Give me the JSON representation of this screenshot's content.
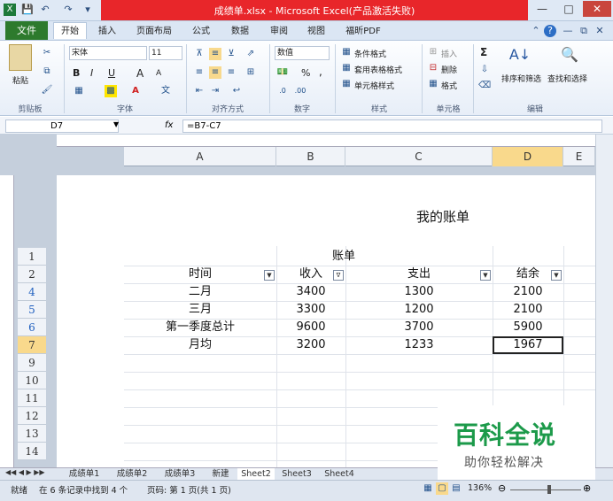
{
  "window": {
    "title": "成绩单.xlsx - Microsoft Excel(产品激活失败)",
    "app_icon": "X"
  },
  "ribbon": {
    "tabs": [
      "文件",
      "开始",
      "插入",
      "页面布局",
      "公式",
      "数据",
      "审阅",
      "视图",
      "福昕PDF"
    ],
    "clipboard": {
      "paste": "粘贴",
      "label": "剪贴板"
    },
    "font": {
      "name": "宋体",
      "size": "11",
      "bold": "B",
      "italic": "I",
      "underline": "U",
      "grow": "A",
      "shrink": "A",
      "label": "字体"
    },
    "alignment": {
      "label": "对齐方式"
    },
    "number": {
      "format": "数值",
      "percent": "%",
      "comma": ",",
      "label": "数字"
    },
    "styles": {
      "conditional": "条件格式",
      "table": "套用表格格式",
      "cell": "单元格样式",
      "label": "样式"
    },
    "cells": {
      "insert": "插入",
      "delete": "删除",
      "format": "格式",
      "label": "单元格"
    },
    "editing": {
      "sum": "Σ",
      "sort": "排序和筛选",
      "find": "查找和选择",
      "label": "编辑"
    }
  },
  "formula_bar": {
    "name_box": "D7",
    "fx": "fx",
    "formula": "=B7-C7"
  },
  "columns": [
    "A",
    "B",
    "C",
    "D",
    "E"
  ],
  "rows": [
    "1",
    "2",
    "4",
    "5",
    "6",
    "7",
    "9",
    "10",
    "11",
    "12",
    "13",
    "14"
  ],
  "page_title": "我的账单",
  "sheet": {
    "title": "账单",
    "headers": [
      "时间",
      "收入",
      "支出",
      "结余"
    ],
    "data": [
      [
        "二月",
        "3400",
        "1300",
        "2100"
      ],
      [
        "三月",
        "3300",
        "1200",
        "2100"
      ],
      [
        "第一季度总计",
        "9600",
        "3700",
        "5900"
      ],
      [
        "月均",
        "3200",
        "1233",
        "1967"
      ]
    ]
  },
  "sheet_tabs": [
    "成绩单1",
    "成绩单2",
    "成绩单3",
    "新建",
    "Sheet2",
    "Sheet3",
    "Sheet4"
  ],
  "status": {
    "ready": "就绪",
    "filter_info": "在 6 条记录中找到 4 个",
    "page_info": "页码: 第 1 页(共 1 页)",
    "zoom": "136%"
  },
  "watermark": {
    "title": "百科全说",
    "subtitle": "助你轻松解决"
  },
  "colors": {
    "title_red": "#e8262a",
    "file_tab": "#2d7a2d",
    "selected_row_header": "#f9d98c",
    "watermark_green": "#1c9a4a"
  }
}
